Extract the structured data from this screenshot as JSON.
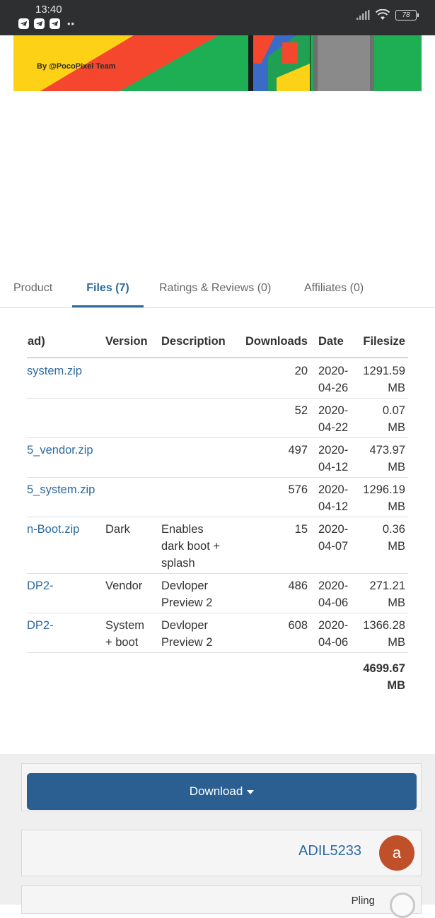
{
  "status_bar": {
    "time": "13:40",
    "battery": "78"
  },
  "banner": {
    "credit": "By @PocoPixel Team"
  },
  "tabs": [
    {
      "label": "Product"
    },
    {
      "label": "Files (7)"
    },
    {
      "label": "Ratings & Reviews (0)"
    },
    {
      "label": "Affiliates (0)"
    }
  ],
  "files_table": {
    "headers": {
      "file": "ad)",
      "version": "Version",
      "description": "Description",
      "downloads": "Downloads",
      "date": "Date",
      "filesize": "Filesize"
    },
    "rows": [
      {
        "file": "system.zip",
        "version": [],
        "description": [],
        "downloads": "20",
        "date": [
          "2020-",
          "04-26"
        ],
        "size": [
          "1291.59",
          "MB"
        ]
      },
      {
        "file": "",
        "version": [],
        "description": [],
        "downloads": "52",
        "date": [
          "2020-",
          "04-22"
        ],
        "size": [
          "0.07",
          "MB"
        ]
      },
      {
        "file": "5_vendor.zip",
        "version": [],
        "description": [],
        "downloads": "497",
        "date": [
          "2020-",
          "04-12"
        ],
        "size": [
          "473.97",
          "MB"
        ]
      },
      {
        "file": "5_system.zip",
        "version": [],
        "description": [],
        "downloads": "576",
        "date": [
          "2020-",
          "04-12"
        ],
        "size": [
          "1296.19",
          "MB"
        ]
      },
      {
        "file": "n-Boot.zip",
        "version": [
          "Dark"
        ],
        "description": [
          "Enables",
          "dark boot +",
          "splash"
        ],
        "downloads": "15",
        "date": [
          "2020-",
          "04-07"
        ],
        "size": [
          "0.36",
          "MB"
        ]
      },
      {
        "file": "DP2-",
        "version": [
          "Vendor"
        ],
        "description": [
          "Devloper",
          "Preview 2"
        ],
        "downloads": "486",
        "date": [
          "2020-",
          "04-06"
        ],
        "size": [
          "271.21",
          "MB"
        ]
      },
      {
        "file": "DP2-",
        "version": [
          "System",
          "+ boot"
        ],
        "description": [
          "Devloper",
          "Preview 2"
        ],
        "downloads": "608",
        "date": [
          "2020-",
          "04-06"
        ],
        "size": [
          "1366.28",
          "MB"
        ]
      }
    ],
    "total": [
      "4699.67",
      "MB"
    ]
  },
  "download_button": {
    "label": "Download"
  },
  "author": {
    "name": "ADIL5233",
    "avatar_letter": "a"
  },
  "footer_card": {
    "label": "Pling"
  },
  "colors": {
    "accent": "#2c6aa0",
    "button": "#2b5f92",
    "avatar": "#c0502a",
    "status_bar": "#2e2f31"
  }
}
